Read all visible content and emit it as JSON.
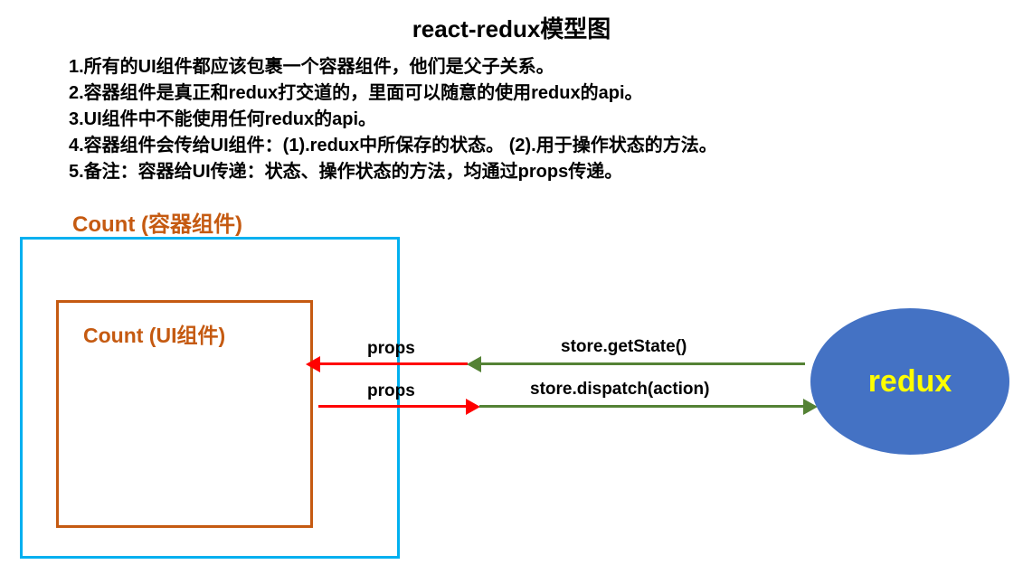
{
  "title": "react-redux模型图",
  "description": {
    "line1": "1.所有的UI组件都应该包裹一个容器组件，他们是父子关系。",
    "line2": "2.容器组件是真正和redux打交道的，里面可以随意的使用redux的api。",
    "line3": "3.UI组件中不能使用任何redux的api。",
    "line4": "4.容器组件会传给UI组件：(1).redux中所保存的状态。  (2).用于操作状态的方法。",
    "line5": "5.备注：容器给UI传递：状态、操作状态的方法，均通过props传递。"
  },
  "diagram": {
    "container_label": "Count (容器组件)",
    "ui_label": "Count (UI组件)",
    "props_in": "props",
    "props_out": "props",
    "getstate": "store.getState()",
    "dispatch": "store.dispatch(action)",
    "redux": "redux"
  }
}
